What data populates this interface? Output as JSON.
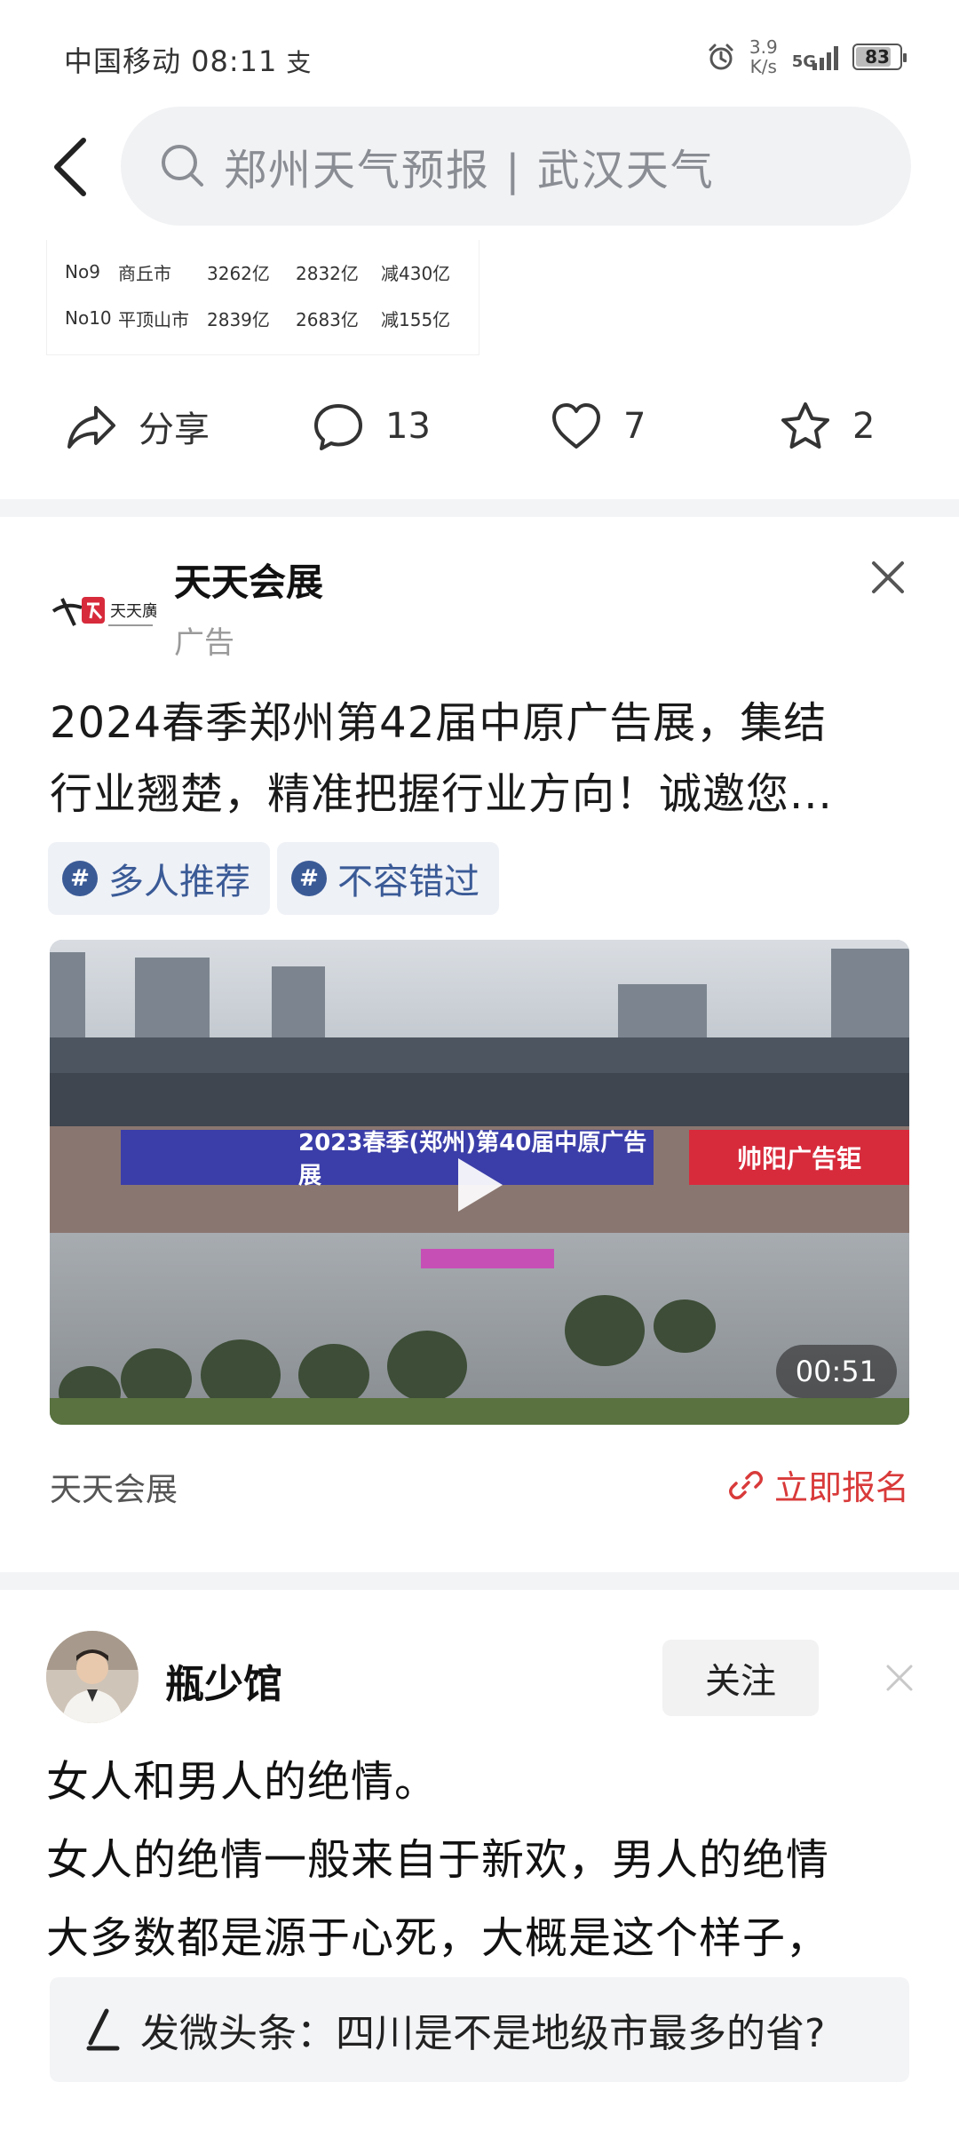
{
  "status_bar": {
    "carrier_time": "中国移动 08:11",
    "pay_icon_glyph": "支",
    "speed_value": "3.9",
    "speed_unit": "K/s",
    "network": "5G",
    "battery": "83",
    "battery_level": 0.83,
    "icons": [
      "alarm-icon",
      "signal-icon",
      "battery-icon"
    ]
  },
  "header": {
    "search_query": "郑州天气预报 | 武汉天气"
  },
  "table_snippet": {
    "rows": [
      [
        "No9",
        "商丘市",
        "3262亿",
        "2832亿",
        "减430亿"
      ],
      [
        "No10",
        "平顶山市",
        "2839亿",
        "2683亿",
        "减155亿"
      ]
    ]
  },
  "actions": {
    "share_label": "分享",
    "comment_count": "13",
    "like_count": "7",
    "favorite_count": "2"
  },
  "ad": {
    "logo_text": "天天廣告",
    "advertiser": "天天会展",
    "label": "广告",
    "title_lines": [
      "2024春季郑州第42届中原广告展，集结",
      "行业翘楚，精准把握行业方向！诚邀您..."
    ],
    "tags": [
      "多人推荐",
      "不容错过"
    ],
    "video": {
      "banner_main": "2023春季(郑州)第40届中原广告展",
      "banner_right": "帅阳广告钜",
      "duration": "00:51"
    },
    "footer_name": "天天会展",
    "signup_label": "立即报名"
  },
  "post": {
    "author": "瓶少馆",
    "follow_label": "关注",
    "text_lines": [
      "女人和男人的绝情。",
      "女人的绝情一般来自于新欢，男人的绝情",
      "大多数都是源于心死，大概是这个样子，"
    ]
  },
  "compose": {
    "prompt": "发微头条：四川是不是地级市最多的省?"
  },
  "colors": {
    "accent_red": "#d93a3a",
    "tag_blue": "#3a5a96",
    "search_bg": "#f1f2f4"
  }
}
